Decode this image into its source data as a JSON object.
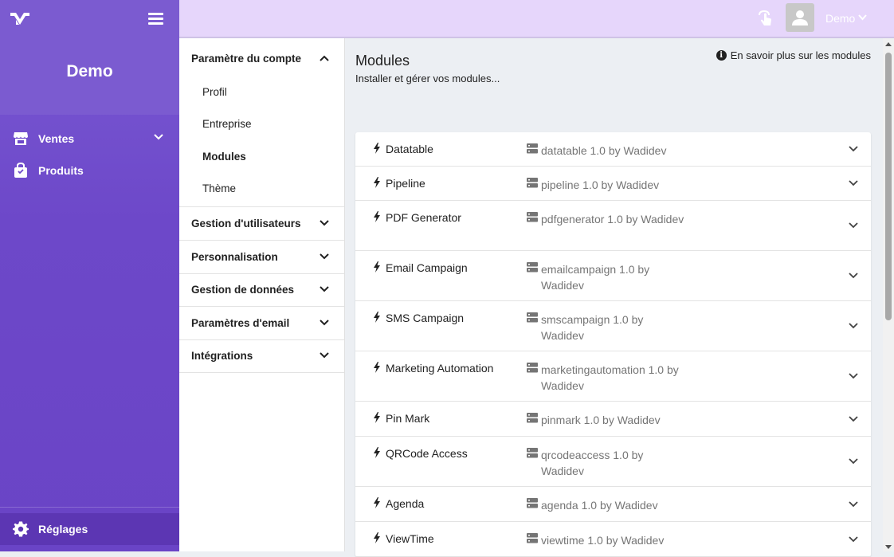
{
  "sidebar": {
    "title": "Demo",
    "items": [
      {
        "label": "Ventes",
        "icon": "store-icon"
      },
      {
        "label": "Produits",
        "icon": "bag-icon"
      }
    ],
    "bottom_item": {
      "label": "Réglages",
      "icon": "gear-icon"
    }
  },
  "topbar": {
    "user_name": "Demo"
  },
  "settings_nav": {
    "sections": [
      {
        "label": "Paramètre du compte",
        "expanded": true
      },
      {
        "label": "Gestion d'utilisateurs",
        "expanded": false
      },
      {
        "label": "Personnalisation",
        "expanded": false
      },
      {
        "label": "Gestion de données",
        "expanded": false
      },
      {
        "label": "Paramètres d'email",
        "expanded": false
      },
      {
        "label": "Intégrations",
        "expanded": false
      }
    ],
    "sub_items": [
      {
        "label": "Profil",
        "active": false
      },
      {
        "label": "Entreprise",
        "active": false
      },
      {
        "label": "Modules",
        "active": true
      },
      {
        "label": "Thème",
        "active": false
      }
    ]
  },
  "main": {
    "title": "Modules",
    "subtitle": "Installer et gérer vos modules...",
    "info_link": "En savoir plus sur les modules",
    "modules": [
      {
        "name": "Datatable",
        "version": "datatable 1.0 by Wadidev"
      },
      {
        "name": "Pipeline",
        "version": "pipeline 1.0 by Wadidev"
      },
      {
        "name": "PDF Generator",
        "version": "pdfgenerator 1.0 by Wadidev"
      },
      {
        "name": "Email Campaign",
        "version": "emailcampaign 1.0 by Wadidev"
      },
      {
        "name": "SMS Campaign",
        "version": "smscampaign 1.0 by Wadidev"
      },
      {
        "name": "Marketing Automation",
        "version": "marketingautomation 1.0 by Wadidev"
      },
      {
        "name": "Pin Mark",
        "version": "pinmark 1.0 by Wadidev"
      },
      {
        "name": "QRCode Access",
        "version": "qrcodeaccess 1.0 by Wadidev"
      },
      {
        "name": "Agenda",
        "version": "agenda 1.0 by Wadidev"
      },
      {
        "name": "ViewTime",
        "version": "viewtime 1.0 by Wadidev"
      }
    ]
  },
  "colors": {
    "sidebar": "#6d48c9",
    "topbar": "#e6d6fb",
    "background": "#eceff3"
  }
}
